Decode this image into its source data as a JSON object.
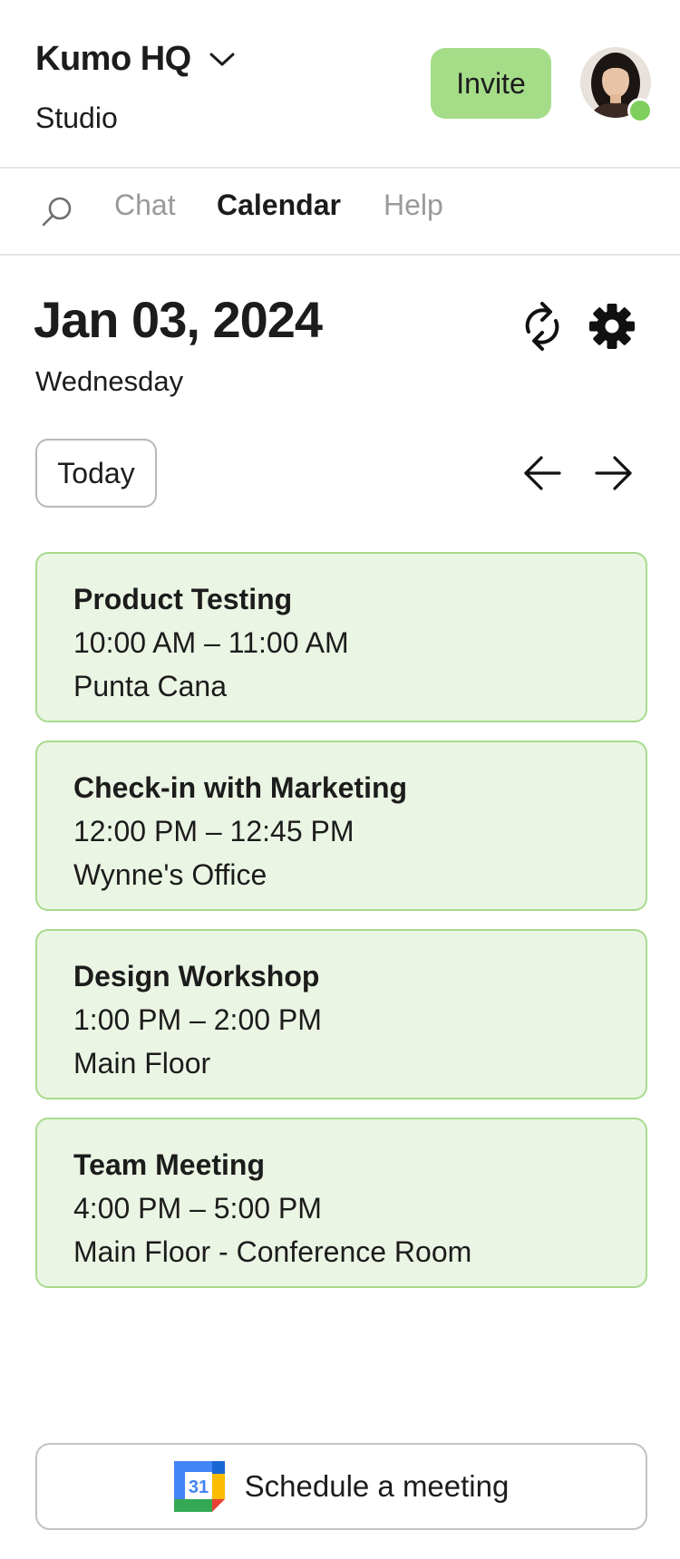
{
  "header": {
    "workspace_name": "Kumo HQ",
    "workspace_type": "Studio",
    "invite_label": "Invite",
    "presence_color": "#7fcf5d",
    "accent_color": "#a5dc88"
  },
  "nav": {
    "tabs": [
      {
        "label": "Chat",
        "active": false
      },
      {
        "label": "Calendar",
        "active": true
      },
      {
        "label": "Help",
        "active": false
      }
    ],
    "icons": [
      "search-icon"
    ]
  },
  "calendar": {
    "date": "Jan 03, 2024",
    "weekday": "Wednesday",
    "today_label": "Today",
    "icons": [
      "sync-icon",
      "gear-icon",
      "arrow-left-icon",
      "arrow-right-icon"
    ],
    "events": [
      {
        "title": "Product Testing",
        "time": "10:00 AM – 11:00 AM",
        "location": "Punta Cana"
      },
      {
        "title": "Check-in with Marketing",
        "time": "12:00 PM – 12:45 PM",
        "location": "Wynne's Office"
      },
      {
        "title": "Design Workshop",
        "time": "1:00 PM – 2:00 PM",
        "location": "Main Floor"
      },
      {
        "title": "Team Meeting",
        "time": "4:00 PM – 5:00 PM",
        "location": "Main Floor - Conference Room"
      }
    ],
    "event_bg": "#ebf5e4",
    "event_border": "#a8db8d"
  },
  "footer": {
    "schedule_label": "Schedule a meeting",
    "calendar_icon_text": "31"
  }
}
